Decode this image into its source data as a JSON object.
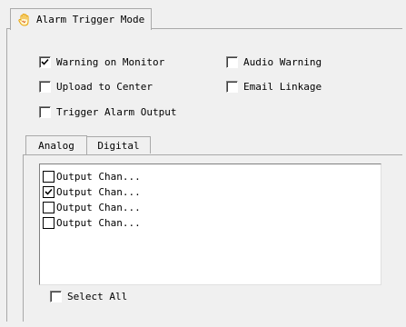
{
  "tab": {
    "label": "Alarm Trigger Mode",
    "icon": "hand-icon"
  },
  "options": {
    "warning_on_monitor": {
      "label": "Warning on Monitor",
      "checked": true
    },
    "audio_warning": {
      "label": "Audio Warning",
      "checked": false
    },
    "upload_to_center": {
      "label": "Upload to Center",
      "checked": false
    },
    "email_linkage": {
      "label": "Email Linkage",
      "checked": false
    },
    "trigger_alarm_output": {
      "label": "Trigger Alarm Output",
      "checked": false
    }
  },
  "sub_tabs": [
    {
      "label": "Analog",
      "active": true
    },
    {
      "label": "Digital",
      "active": false
    }
  ],
  "outputs": [
    {
      "label": "Output Chan...",
      "checked": false
    },
    {
      "label": "Output Chan...",
      "checked": true
    },
    {
      "label": "Output Chan...",
      "checked": false
    },
    {
      "label": "Output Chan...",
      "checked": false
    }
  ],
  "select_all": {
    "label": "Select All",
    "checked": false
  },
  "colors": {
    "background": "#f0f0f0",
    "border": "#a9a9a9",
    "hand_icon": "#e8a000"
  }
}
